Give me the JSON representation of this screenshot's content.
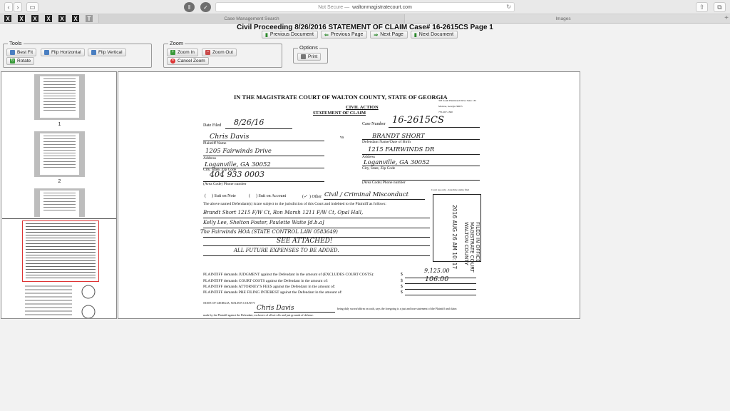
{
  "browser": {
    "security_label": "Not Secure —",
    "domain": "waltonmagistratecourt.com",
    "tabs": [
      "Case Management Search",
      "Images"
    ],
    "favorites": [
      "X",
      "X",
      "X",
      "X",
      "X",
      "X",
      "T"
    ]
  },
  "header": {
    "title": "Civil Proceeding 8/26/2016 STATEMENT OF CLAIM Case# 16-2615CS Page 1",
    "nav": [
      "Previous Document",
      "Previous Page",
      "Next Page",
      "Next Document"
    ]
  },
  "tools": {
    "title": "Tools",
    "best_fit": "Best Fit",
    "flip_horizontal": "Flip Horizontal",
    "flip_vertical": "Flip Vertical",
    "rotate": "Rotate"
  },
  "zoom": {
    "title": "Zoom",
    "zoom_in": "Zoom In",
    "zoom_out": "Zoom Out",
    "cancel_zoom": "Cancel Zoom"
  },
  "options": {
    "title": "Options",
    "print": "Print"
  },
  "thumbnails": {
    "labels": [
      "1",
      "2"
    ]
  },
  "document": {
    "court_heading": "IN THE MAGISTRATE COURT OF WALTON COUNTY, STATE OF GEORGIA",
    "address_lines": [
      "303 South Hammond Drive Suite 135",
      "Monroe, Georgia 30655",
      "770-267-1360"
    ],
    "civil_action": "CIVIL ACTION",
    "statement": "STATEMENT OF CLAIM",
    "date_filed_label": "Date Filed",
    "date_filed_value": "8/26/16",
    "case_number_label": "Case Number",
    "case_number_value": "16-2615CS",
    "plaintiff_value": "Chris Davis",
    "vs": "vs",
    "defendant_value": "BRANDT SHORT",
    "plaintiff_name_label": "Plaintiff Name",
    "defendant_name_label": "Defendant Name/Date of Birth",
    "plaintiff_address_value": "1205 Fairwinds Drive",
    "defendant_address_value": "1215 FAIRWINDS DR",
    "address_label": "Address",
    "plaintiff_city_value": "Loganville, GA 30052",
    "defendant_city_value": "Loganville, GA 30052",
    "city_label": "City, State, Zip Code",
    "plaintiff_phone_value": "404 933 0003",
    "phone_label": "(Area Code) Phone number",
    "suit_note": "Suit on Note",
    "suit_account": "Suit on Account",
    "other_label": "Other",
    "other_value": "Civil / Criminal Misconduct",
    "court_use_label": "Court use only - date/time stamp filed",
    "jurisdiction_text": "The above named Defendant(s) is/are subject to the jurisdiction of this Court and indebted to the Plaintiff as follows:",
    "claim_lines": [
      "Brandt Short 1215 F/W Ct, Ron Marsh 1211 F/W Ct, Opal Hall,",
      "Kelly Lee, Shelton Foster, Paulette Waite [d.b.a]",
      "The Fairwinds HOA (STATE CONTROL LAW 0583649)",
      "SEE ATTACHED!",
      "ALL FUTURE EXPENSES TO BE ADDED."
    ],
    "stamp_lines": [
      "FILED IN OFFICE",
      "MAGISTRATE COURT",
      "WALTON COUNTY",
      "2016 AUG 26  AM 10: 17"
    ],
    "demands": [
      "PLAINTIFF demands JUDGMENT against the Defendant in the amount of (EXCLUDES COURT COSTS):",
      "PLAINTIFF demands COURT COSTS against the Defendant in the amount of:",
      "PLAINTIFF demands ATTORNEY'S FEES against the Defendant in the amount of:",
      "PLAINTIFF demands PRE FILING INTEREST against the Defendant in the amount of:"
    ],
    "currency": "$",
    "amount_judgment": "9,125.00",
    "amount_costs": "106.00",
    "state_label": "STATE OF GEORGIA, WALTON COUNTY",
    "sign_value": "Chris Davis",
    "oath_text": "being duly sworn/affirm on oath, says the foregoing is a just and true statement of the Plaintiff and claim",
    "oath_text_2": "made by the Plaintiff against the Defendant, exclusive of all set-offs and just grounds of defense."
  },
  "colors": {
    "accent_green": "#2d8a2d",
    "selected_border": "#d33333"
  }
}
